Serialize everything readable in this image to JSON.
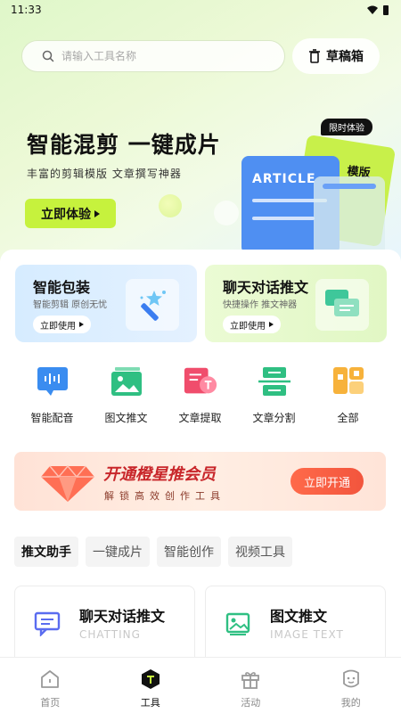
{
  "status_bar": {
    "time": "11:33"
  },
  "search": {
    "placeholder": "请输入工具名称"
  },
  "drafts": {
    "label": "草稿箱"
  },
  "hero": {
    "title": "智能混剪 一键成片",
    "subtitle": "丰富的剪辑模版 文章撰写神器",
    "cta": "立即体验",
    "tag": "限时体验",
    "card_article": "ARTICLE",
    "card_template": "模版"
  },
  "features": [
    {
      "title": "智能包装",
      "subtitle": "智能剪辑 原创无忧",
      "button": "立即使用",
      "icon": "magic-wand-icon"
    },
    {
      "title": "聊天对话推文",
      "subtitle": "快捷操作 推文神器",
      "button": "立即使用",
      "icon": "chat-bubbles-icon"
    }
  ],
  "tools": [
    {
      "label": "智能配音",
      "icon": "voice-icon"
    },
    {
      "label": "图文推文",
      "icon": "image-icon"
    },
    {
      "label": "文章提取",
      "icon": "text-extract-icon"
    },
    {
      "label": "文章分割",
      "icon": "split-icon"
    },
    {
      "label": "全部",
      "icon": "grid-icon"
    }
  ],
  "vip": {
    "title": "开通橙星推会员",
    "subtitle": "解锁高效创作工具",
    "button": "立即开通"
  },
  "categories": [
    {
      "label": "推文助手",
      "active": true
    },
    {
      "label": "一键成片",
      "active": false
    },
    {
      "label": "智能创作",
      "active": false
    },
    {
      "label": "视频工具",
      "active": false
    }
  ],
  "list": [
    {
      "title": "聊天对话推文",
      "subtitle": "CHATTING",
      "icon": "chat-icon"
    },
    {
      "title": "图文推文",
      "subtitle": "IMAGE TEXT",
      "icon": "picture-icon"
    }
  ],
  "tabbar": [
    {
      "label": "首页",
      "icon": "home-icon",
      "active": false
    },
    {
      "label": "工具",
      "icon": "tools-icon",
      "active": true
    },
    {
      "label": "活动",
      "icon": "gift-icon",
      "active": false
    },
    {
      "label": "我的",
      "icon": "profile-icon",
      "active": false
    }
  ],
  "colors": {
    "accent": "#c6f23d",
    "vip_red": "#c8262a",
    "blue": "#4f8ff2"
  }
}
